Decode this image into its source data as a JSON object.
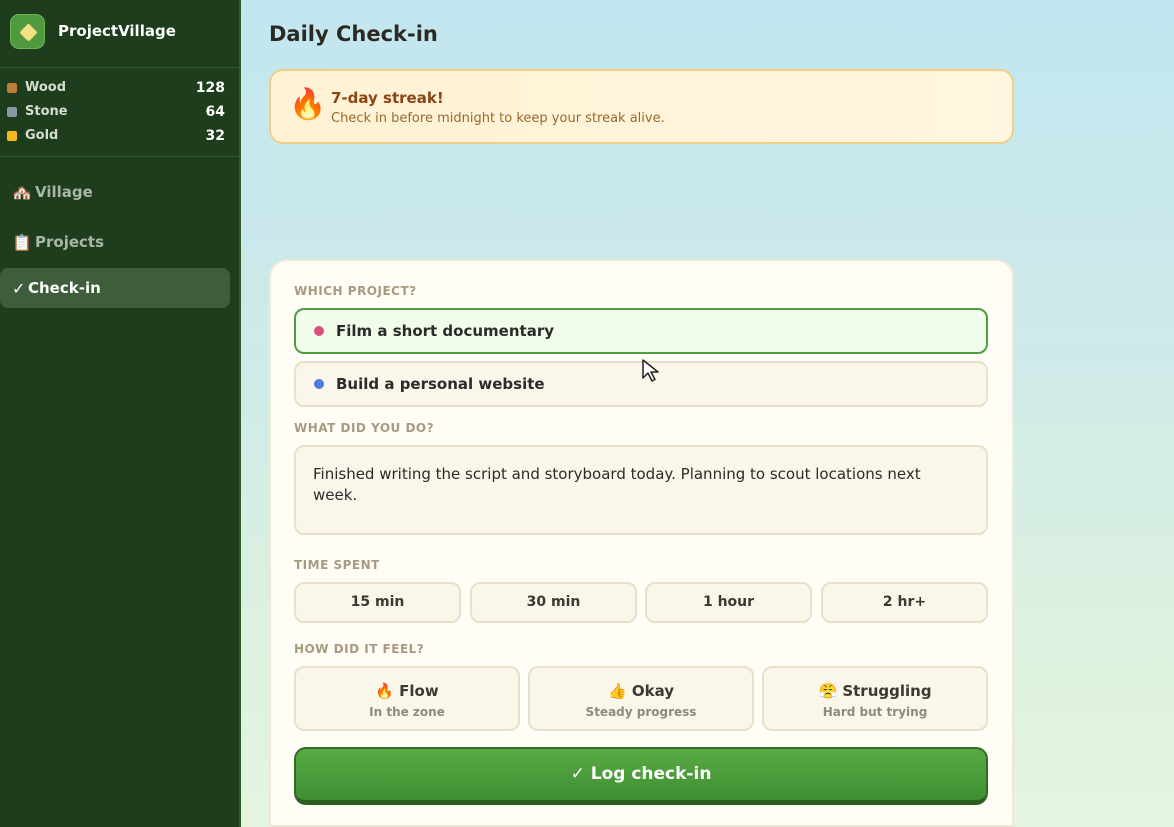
{
  "app": {
    "name": "ProjectVillage"
  },
  "resources": [
    {
      "name": "Wood",
      "value": "128",
      "color": "#c07a3a"
    },
    {
      "name": "Stone",
      "value": "64",
      "color": "#8a98a6"
    },
    {
      "name": "Gold",
      "value": "32",
      "color": "#f2b81c"
    }
  ],
  "nav": [
    {
      "icon": "🏘️",
      "label": "Village",
      "active": false
    },
    {
      "icon": "📋",
      "label": "Projects",
      "active": false
    },
    {
      "icon": "✓",
      "label": "Check-in",
      "active": true
    }
  ],
  "page": {
    "title": "Daily Check-in"
  },
  "streak": {
    "icon": "🔥",
    "title": "7-day streak!",
    "subtitle": "Check in before midnight to keep your streak alive."
  },
  "form": {
    "project_label": "WHICH PROJECT?",
    "projects": [
      {
        "name": "Film a short documentary",
        "color": "#d9517a",
        "selected": true
      },
      {
        "name": "Build a personal website",
        "color": "#4a7de0",
        "selected": false
      }
    ],
    "notes_label": "WHAT DID YOU DO?",
    "notes_value": "Finished writing the script and storyboard today. Planning to scout locations next week.",
    "time_label": "TIME SPENT",
    "time_options": [
      "15 min",
      "30 min",
      "1 hour",
      "2 hr+"
    ],
    "feel_label": "HOW DID IT FEEL?",
    "feel_options": [
      {
        "title": "🔥 Flow",
        "subtitle": "In the zone"
      },
      {
        "title": "👍 Okay",
        "subtitle": "Steady progress"
      },
      {
        "title": "😤 Struggling",
        "subtitle": "Hard but trying"
      }
    ],
    "submit_label": "✓ Log check-in"
  }
}
